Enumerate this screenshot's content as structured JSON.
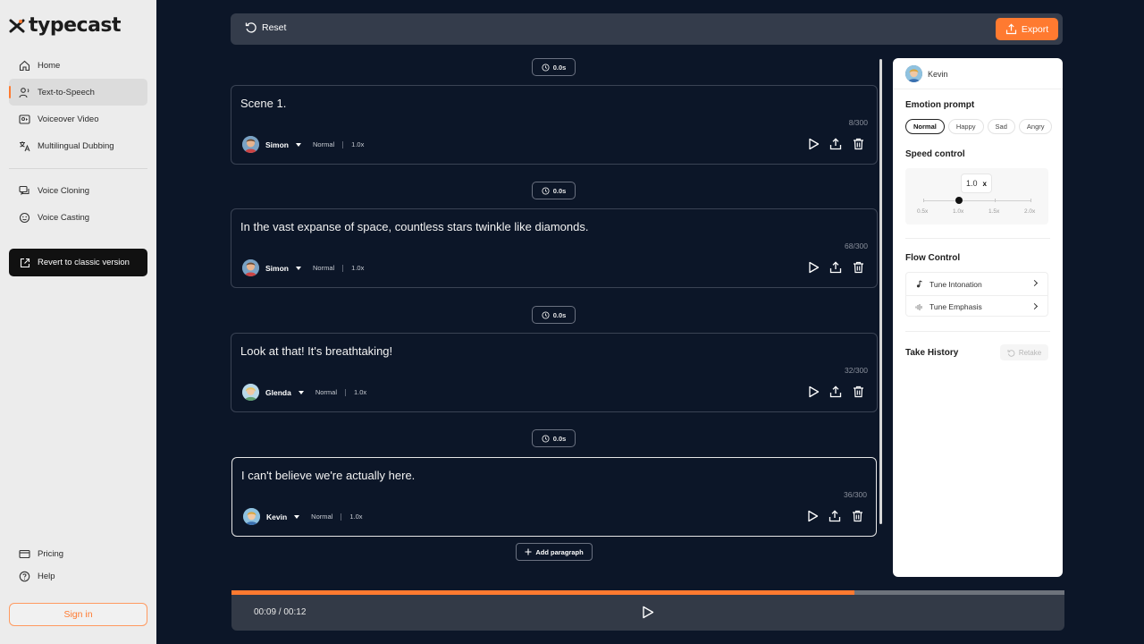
{
  "brand": {
    "name": "typecast",
    "accent": "#ff7a30"
  },
  "sidebar": {
    "nav": [
      {
        "label": "Home",
        "icon": "home-icon"
      },
      {
        "label": "Text-to-Speech",
        "icon": "voice-person-icon",
        "active": true
      },
      {
        "label": "Voiceover Video",
        "icon": "video-icon"
      },
      {
        "label": "Multilingual Dubbing",
        "icon": "translate-icon"
      }
    ],
    "nav2": [
      {
        "label": "Voice Cloning",
        "icon": "chat-clone-icon"
      },
      {
        "label": "Voice Casting",
        "icon": "face-icon"
      }
    ],
    "revert_label": "Revert to classic version",
    "bottom": [
      {
        "label": "Pricing",
        "icon": "card-icon"
      },
      {
        "label": "Help",
        "icon": "help-icon"
      }
    ],
    "signin_label": "Sign in"
  },
  "toolbar": {
    "reset_label": "Reset",
    "export_label": "Export"
  },
  "pause_label": "0.0s",
  "scenes": [
    {
      "text": "Scene 1.",
      "count": "8/300",
      "voice": "Simon",
      "emotion": "Normal",
      "speed": "1.0x"
    },
    {
      "text": "In the vast expanse of space, countless stars twinkle like diamonds.",
      "count": "68/300",
      "voice": "Simon",
      "emotion": "Normal",
      "speed": "1.0x"
    },
    {
      "text": "Look at that! It's breathtaking!",
      "count": "32/300",
      "voice": "Glenda",
      "emotion": "Normal",
      "speed": "1.0x"
    },
    {
      "text": "I can't believe we're actually here.",
      "count": "36/300",
      "voice": "Kevin",
      "emotion": "Normal",
      "speed": "1.0x"
    }
  ],
  "add_paragraph_label": "Add paragraph",
  "panel": {
    "voice_name": "Kevin",
    "emotion_title": "Emotion prompt",
    "emotions": [
      "Normal",
      "Happy",
      "Sad",
      "Angry"
    ],
    "selected_emotion": "Normal",
    "speed_title": "Speed control",
    "speed_value": "1.0",
    "speed_unit": "x",
    "speed_marks": [
      "0.5x",
      "1.0x",
      "1.5x",
      "2.0x"
    ],
    "speed_fraction": 0.333,
    "flow_title": "Flow Control",
    "flow_items": [
      "Tune Intonation",
      "Tune Emphasis"
    ],
    "history_title": "Take History",
    "retake_label": "Retake"
  },
  "player": {
    "time": "00:09 / 00:12",
    "progress": 0.748
  }
}
